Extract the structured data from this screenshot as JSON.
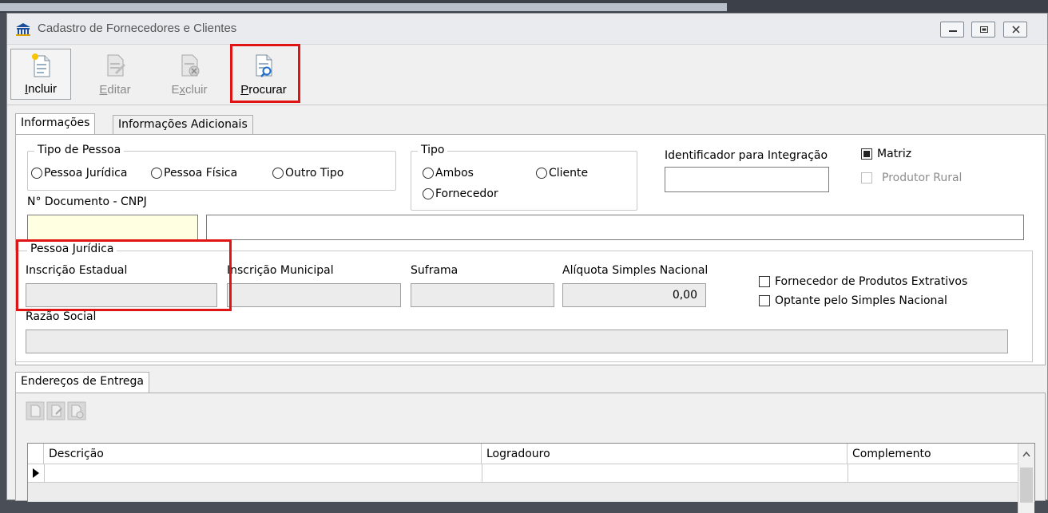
{
  "window": {
    "title": "Cadastro de Fornecedores e Clientes"
  },
  "toolbar": {
    "incluir": {
      "pre": "",
      "u": "I",
      "post": "ncluir"
    },
    "editar": {
      "pre": "",
      "u": "E",
      "post": "ditar"
    },
    "excluir": {
      "pre": "E",
      "u": "x",
      "post": "cluir"
    },
    "procurar": {
      "pre": "",
      "u": "P",
      "post": "rocurar"
    }
  },
  "tabs": [
    "Informações",
    "Informações Adicionais"
  ],
  "tipo_pessoa": {
    "title": "Tipo de Pessoa",
    "options": [
      "Pessoa Jurídica",
      "Pessoa Física",
      "Outro Tipo"
    ]
  },
  "tipo": {
    "title": "Tipo",
    "options": [
      "Ambos",
      "Cliente",
      "Fornecedor"
    ]
  },
  "identificador": {
    "label": "Identificador para Integração",
    "value": ""
  },
  "matriz": {
    "label": "Matriz",
    "checked": true
  },
  "produtor_rural": {
    "label": "Produtor Rural",
    "checked": false
  },
  "documento": {
    "label": "N° Documento - CNPJ",
    "value": "",
    "name_value": ""
  },
  "pessoa_juridica": {
    "title": "Pessoa Jurídica",
    "inscricao_estadual": "Inscrição Estadual",
    "inscricao_municipal": "Inscrição Municipal",
    "suframa": "Suframa",
    "aliquota": "Alíquota Simples Nacional",
    "aliquota_value": "0,00",
    "razao_social": "Razão Social",
    "fornecedor_extrativos": "Fornecedor de Produtos Extrativos",
    "optante_simples": "Optante pelo Simples Nacional"
  },
  "enderecos": {
    "tab": "Endereços de Entrega",
    "columns": [
      "Descrição",
      "Logradouro",
      "Complemento"
    ]
  }
}
